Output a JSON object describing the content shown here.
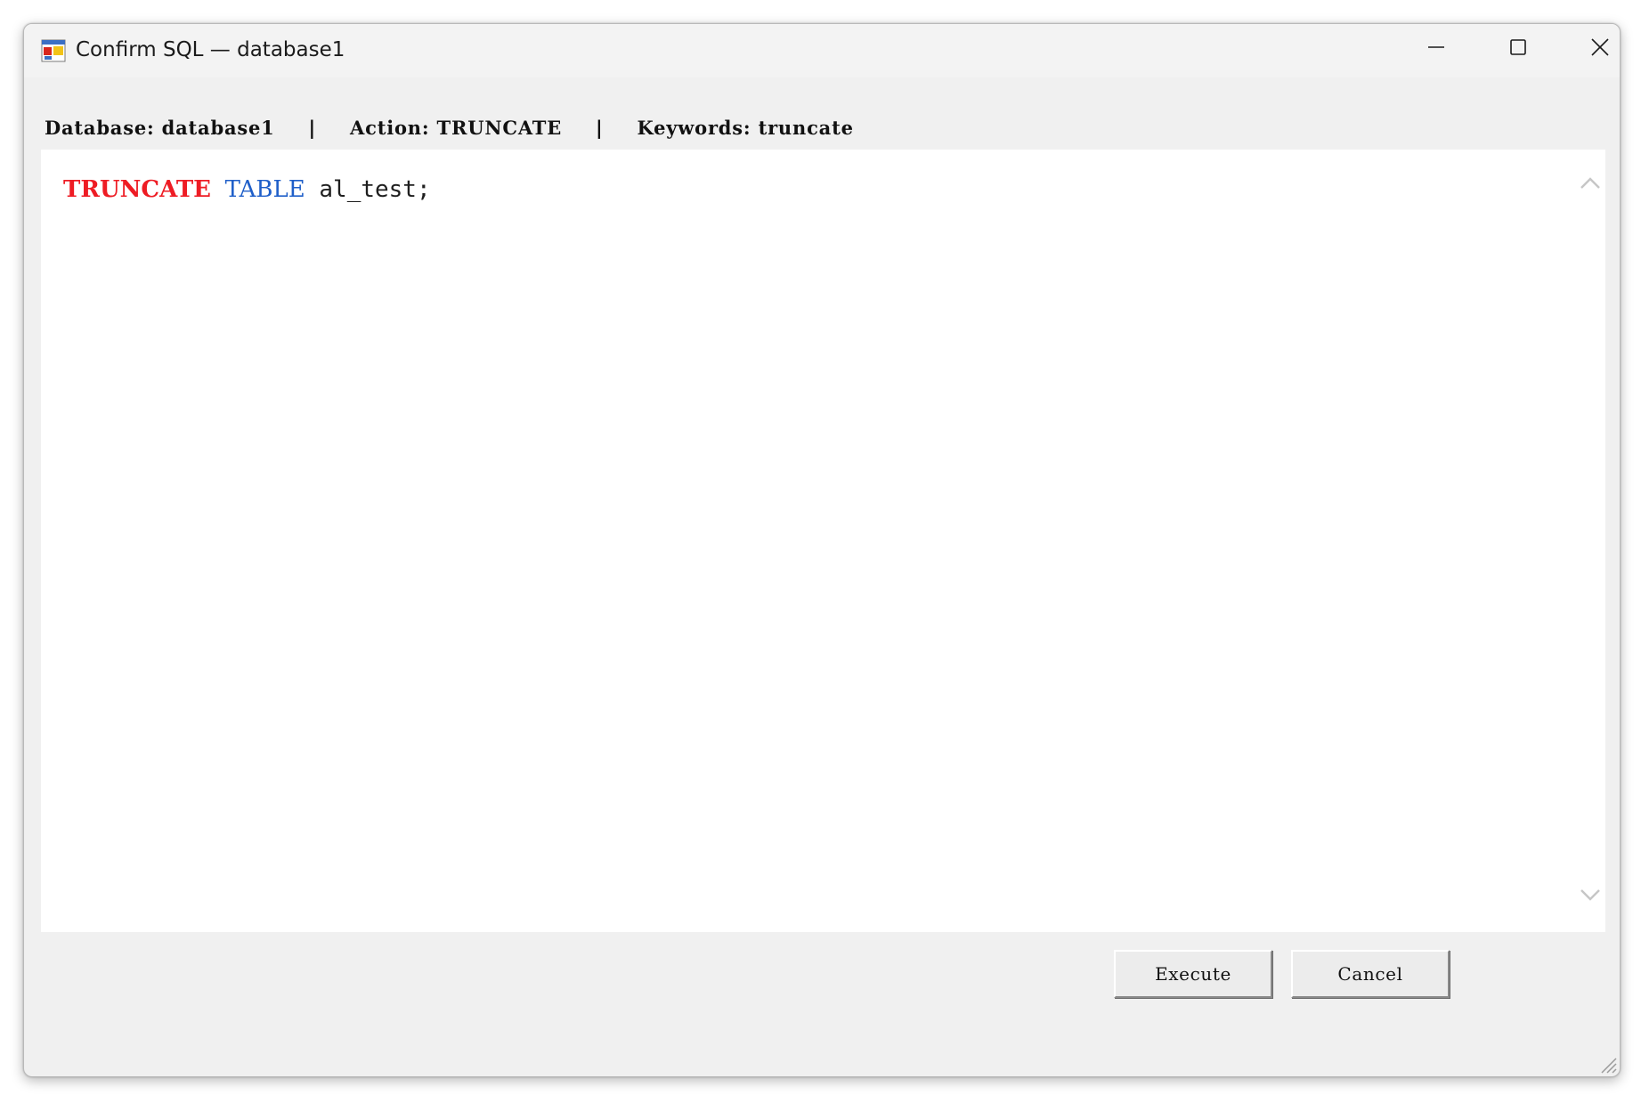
{
  "window": {
    "title": "Confirm SQL — database1"
  },
  "info": {
    "database": "Database: database1",
    "separator": "|",
    "action": "Action: TRUNCATE",
    "keywords": "Keywords: truncate"
  },
  "editor": {
    "tokens": {
      "keyword_truncate": "TRUNCATE",
      "keyword_table": "TABLE",
      "table_name": "al_test;"
    }
  },
  "buttons": {
    "execute": "Execute",
    "cancel": "Cancel"
  },
  "colors": {
    "truncate_keyword": "#ee1c24",
    "table_keyword": "#1f5fc9",
    "window_background": "#f0f0f0",
    "editor_background": "#ffffff"
  },
  "icons": {
    "app": "app-window-icon",
    "minimize": "minimize-icon",
    "maximize": "maximize-icon",
    "close": "close-icon",
    "scroll_up": "chevron-up-icon",
    "scroll_down": "chevron-down-icon",
    "resize": "resize-grip-icon"
  }
}
